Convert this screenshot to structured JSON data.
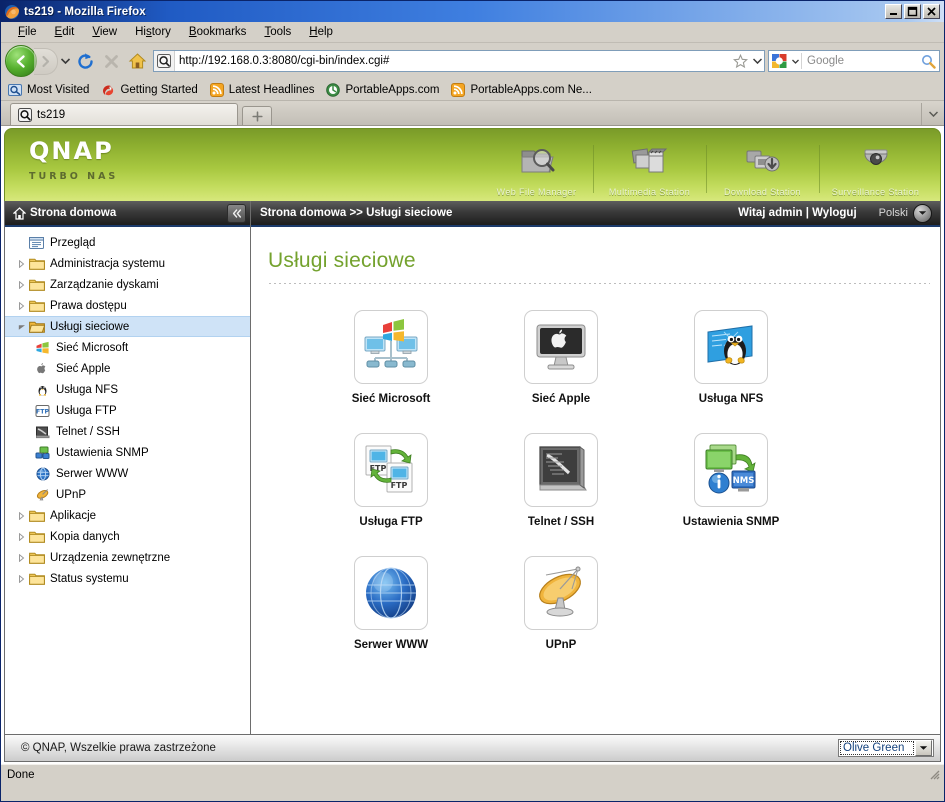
{
  "window": {
    "title": "ts219 - Mozilla Firefox",
    "icon": "firefox-icon",
    "minimize_label": "Minimize",
    "maximize_label": "Maximize",
    "close_label": "Close"
  },
  "menubar": {
    "items": [
      {
        "label": "File",
        "accel": "F"
      },
      {
        "label": "Edit",
        "accel": "E"
      },
      {
        "label": "View",
        "accel": "V"
      },
      {
        "label": "History",
        "accel": "s"
      },
      {
        "label": "Bookmarks",
        "accel": "B"
      },
      {
        "label": "Tools",
        "accel": "T"
      },
      {
        "label": "Help",
        "accel": "H"
      }
    ]
  },
  "toolbar": {
    "back_label": "Back",
    "forward_label": "Forward",
    "reload_label": "Reload",
    "stop_label": "Stop",
    "home_label": "Home",
    "url": "http://192.168.0.3:8080/cgi-bin/index.cgi#",
    "bookmark_star_label": "Bookmark this page",
    "search_engine": "Google",
    "search_placeholder": "Google",
    "search_value": ""
  },
  "bookmarks": {
    "items": [
      {
        "label": "Most Visited",
        "icon": "most-visited-icon"
      },
      {
        "label": "Getting Started",
        "icon": "firefox-head-icon"
      },
      {
        "label": "Latest Headlines",
        "icon": "rss-icon"
      },
      {
        "label": "PortableApps.com",
        "icon": "portableapps-icon"
      },
      {
        "label": "PortableApps.com Ne...",
        "icon": "rss-icon"
      }
    ]
  },
  "tabs": {
    "active": "ts219",
    "items": [
      {
        "label": "ts219",
        "icon": "qnap-favicon"
      }
    ],
    "new_tab_label": "+",
    "list_all_label": "List all tabs"
  },
  "qnap_header": {
    "brand": "QNAP",
    "tagline": "TURBO NAS",
    "nav": [
      {
        "label": "Web File Manager",
        "icon": "file-manager-icon"
      },
      {
        "label": "Multimedia Station",
        "icon": "multimedia-icon"
      },
      {
        "label": "Download Station",
        "icon": "download-icon"
      },
      {
        "label": "Surveillance Station",
        "icon": "camera-icon"
      }
    ]
  },
  "sidebar": {
    "header": "Strona domowa",
    "header_icon": "home-icon",
    "collapse_label": "«",
    "footer": "© QNAP, Wszelkie prawa zastrzeżone",
    "items": [
      {
        "label": "Przegląd",
        "icon": "overview-icon",
        "type": "leaf",
        "level": 0,
        "selected": false
      },
      {
        "label": "Administracja systemu",
        "icon": "folder-icon",
        "type": "folder",
        "level": 0,
        "selected": false
      },
      {
        "label": "Zarządzanie dyskami",
        "icon": "folder-icon",
        "type": "folder",
        "level": 0,
        "selected": false
      },
      {
        "label": "Prawa dostępu",
        "icon": "folder-icon",
        "type": "folder",
        "level": 0,
        "selected": false
      },
      {
        "label": "Usługi sieciowe",
        "icon": "folder-open-icon",
        "type": "folder-open",
        "level": 0,
        "selected": true
      },
      {
        "label": "Sieć Microsoft",
        "icon": "windows-icon",
        "type": "child",
        "level": 1,
        "selected": false
      },
      {
        "label": "Sieć Apple",
        "icon": "apple-icon",
        "type": "child",
        "level": 1,
        "selected": false
      },
      {
        "label": "Usługa NFS",
        "icon": "linux-icon",
        "type": "child",
        "level": 1,
        "selected": false
      },
      {
        "label": "Usługa FTP",
        "icon": "ftp-icon",
        "type": "child",
        "level": 1,
        "selected": false
      },
      {
        "label": "Telnet / SSH",
        "icon": "terminal-icon",
        "type": "child",
        "level": 1,
        "selected": false
      },
      {
        "label": "Ustawienia SNMP",
        "icon": "snmp-icon",
        "type": "child",
        "level": 1,
        "selected": false
      },
      {
        "label": "Serwer WWW",
        "icon": "globe-icon",
        "type": "child",
        "level": 1,
        "selected": false
      },
      {
        "label": "UPnP",
        "icon": "satellite-icon",
        "type": "child",
        "level": 1,
        "selected": false
      },
      {
        "label": "Aplikacje",
        "icon": "folder-icon",
        "type": "folder",
        "level": 0,
        "selected": false
      },
      {
        "label": "Kopia danych",
        "icon": "folder-icon",
        "type": "folder",
        "level": 0,
        "selected": false
      },
      {
        "label": "Urządzenia zewnętrzne",
        "icon": "folder-icon",
        "type": "folder",
        "level": 0,
        "selected": false
      },
      {
        "label": "Status systemu",
        "icon": "folder-icon",
        "type": "folder",
        "level": 0,
        "selected": false
      }
    ]
  },
  "breadcrumb": {
    "path": "Strona domowa >> Usługi sieciowe",
    "welcome": "Witaj admin | Wyloguj",
    "language": "Polski"
  },
  "page": {
    "title": "Usługi sieciowe",
    "tiles": [
      [
        {
          "label": "Sieć Microsoft",
          "icon": "windows-network-icon"
        },
        {
          "label": "Sieć Apple",
          "icon": "apple-display-icon"
        },
        {
          "label": "Usługa NFS",
          "icon": "linux-tux-icon"
        }
      ],
      [
        {
          "label": "Usługa FTP",
          "icon": "ftp-transfer-icon"
        },
        {
          "label": "Telnet / SSH",
          "icon": "terminal-screen-icon"
        },
        {
          "label": "Ustawienia SNMP",
          "icon": "snmp-nms-icon"
        }
      ],
      [
        {
          "label": "Serwer WWW",
          "icon": "blue-globe-icon"
        },
        {
          "label": "UPnP",
          "icon": "satellite-dish-icon"
        }
      ]
    ]
  },
  "footer": {
    "copyright": "© QNAP, Wszelkie prawa zastrzeżone",
    "theme_value": "Olive Green",
    "theme_options": [
      "Olive Green"
    ]
  },
  "statusbar": {
    "text": "Done"
  },
  "colors": {
    "accent_green": "#74a22e",
    "header_green_top": "#7a9b29",
    "header_green_bottom": "#d7e87c",
    "selection_blue": "#cfe3f7",
    "titlebar_blue": "#205bc4"
  }
}
